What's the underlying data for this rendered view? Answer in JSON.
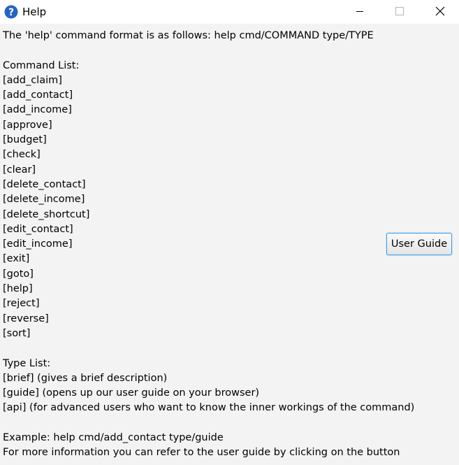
{
  "window": {
    "title": "Help",
    "icon": "question-icon",
    "accent": "#2463c4"
  },
  "help": {
    "intro": "The 'help' command format is as follows: help cmd/COMMAND type/TYPE",
    "command_header": "Command List:",
    "commands": [
      "[add_claim]",
      "[add_contact]",
      "[add_income]",
      "[approve]",
      "[budget]",
      "[check]",
      "[clear]",
      "[delete_contact]",
      "[delete_income]",
      "[delete_shortcut]",
      "[edit_contact]",
      "[edit_income]",
      "[exit]",
      "[goto]",
      "[help]",
      "[reject]",
      "[reverse]",
      "[sort]"
    ],
    "type_header": "Type List:",
    "types": [
      "[brief] (gives a brief description)",
      "[guide] (opens up our user guide on your browser)",
      "[api] (for advanced users who want to know the inner workings of the command)"
    ],
    "example": "Example: help cmd/add_contact type/guide",
    "more_info": "For more information you can refer to the user guide by clicking on the button"
  },
  "buttons": {
    "user_guide": "User Guide"
  }
}
